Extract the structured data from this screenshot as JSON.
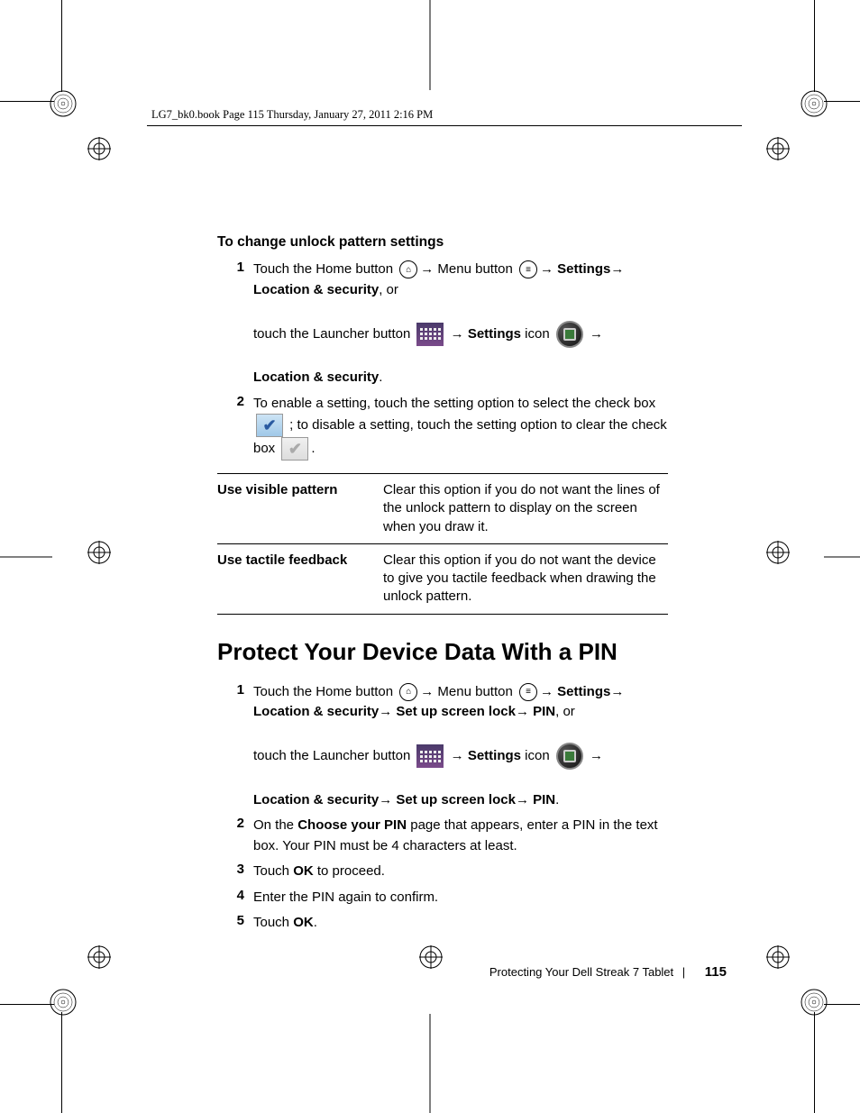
{
  "header": "LG7_bk0.book  Page 115  Thursday, January 27, 2011  2:16 PM",
  "arrow": "→",
  "sec1": {
    "title": "To change unlock pattern settings",
    "s1a": "Touch the Home button ",
    "s1b": " Menu button ",
    "s1c": "Settings",
    "s1d": "Location & security",
    "s1e": ", or",
    "s1f": "touch the Launcher button",
    "s1g": "Settings",
    "s1h": " icon ",
    "s1i": "Location & security",
    "s1j": ".",
    "s2a": "To enable a setting, touch the setting option to select the check box ",
    "s2b": "; to disable a setting, touch the setting option to clear the check box ",
    "s2c": "."
  },
  "table": {
    "r1l": "Use visible pattern",
    "r1v": "Clear this option if you do not want the lines of the unlock pattern to display on the screen when you draw it.",
    "r2l": "Use tactile feedback",
    "r2v": "Clear this option if you do not want the device to give you tactile feedback when drawing the unlock pattern."
  },
  "sec2": {
    "title": "Protect Your Device Data With a PIN",
    "s1a": "Touch the Home button ",
    "s1b": " Menu button ",
    "s1c": "Settings",
    "s1d": "Location & security",
    "s1e": " Set up screen lock",
    "s1f": " PIN",
    "s1g": ", or",
    "s1h": "touch the Launcher button",
    "s1i": "Settings",
    "s1j": " icon ",
    "s1k": "Location & security",
    "s1l": " Set up screen lock",
    "s1m": " PIN",
    "s1n": ".",
    "s2a": "On the ",
    "s2b": "Choose your PIN",
    "s2c": " page that appears, enter a PIN in the text box. Your PIN must be 4 characters at least.",
    "s3a": "Touch ",
    "s3b": "OK",
    "s3c": " to proceed.",
    "s4": "Enter the PIN again to confirm.",
    "s5a": "Touch ",
    "s5b": "OK",
    "s5c": "."
  },
  "footer": {
    "chapter": "Protecting Your Dell Streak 7 Tablet",
    "page": "115"
  }
}
